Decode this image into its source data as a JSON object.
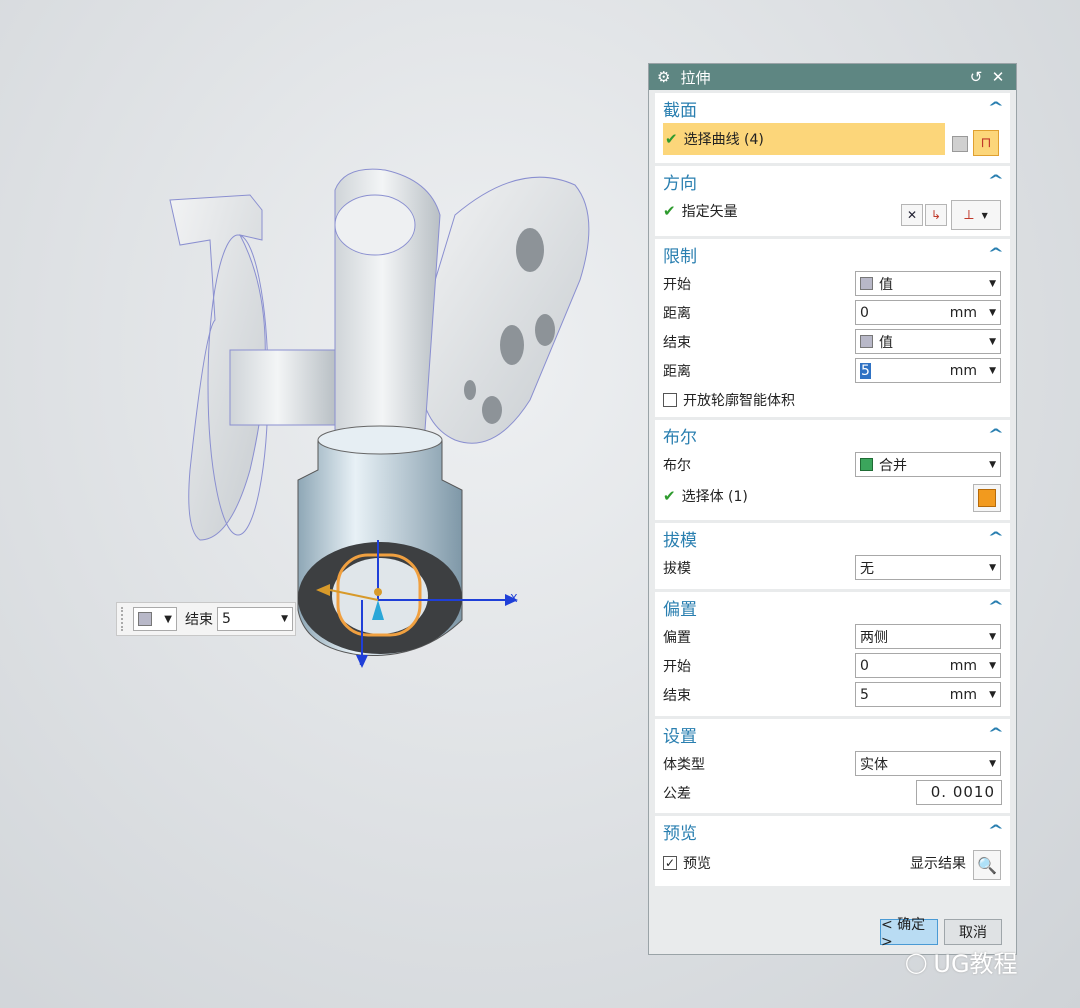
{
  "dialog": {
    "title": "拉伸",
    "sections": {
      "section": {
        "title": "截面",
        "select_curve": "选择曲线 (4)"
      },
      "direction": {
        "title": "方向",
        "specify_vector": "指定矢量"
      },
      "limits": {
        "title": "限制",
        "start_label": "开始",
        "start_value": "值",
        "distance1_label": "距离",
        "distance1_value": "0",
        "distance1_unit": "mm",
        "end_label": "结束",
        "end_value": "值",
        "distance2_label": "距离",
        "distance2_value": "5",
        "distance2_unit": "mm",
        "open_profile_label": "开放轮廓智能体积",
        "open_profile_checked": false
      },
      "boolean": {
        "title": "布尔",
        "boolean_label": "布尔",
        "boolean_value": "合并",
        "select_body": "选择体 (1)"
      },
      "draft": {
        "title": "拔模",
        "draft_label": "拔模",
        "draft_value": "无"
      },
      "offset": {
        "title": "偏置",
        "offset_label": "偏置",
        "offset_value": "两侧",
        "start_label": "开始",
        "start_value": "0",
        "start_unit": "mm",
        "end_label": "结束",
        "end_value": "5",
        "end_unit": "mm"
      },
      "settings": {
        "title": "设置",
        "body_type_label": "体类型",
        "body_type_value": "实体",
        "tolerance_label": "公差",
        "tolerance_value": "0. 0010"
      },
      "preview": {
        "title": "预览",
        "preview_label": "预览",
        "preview_checked": true,
        "show_result_label": "显示结果"
      }
    },
    "buttons": {
      "ok": "< 确定 >",
      "cancel": "取消"
    }
  },
  "mini_toolbar": {
    "label": "结束",
    "value": "5"
  },
  "axes": {
    "x": "X",
    "y": "Y"
  },
  "watermark": "UG教程",
  "colors": {
    "titlebar": "#5e8682",
    "section_title": "#2a7fb0",
    "selection": "#fcd67a",
    "check": "#2e9b2e"
  }
}
